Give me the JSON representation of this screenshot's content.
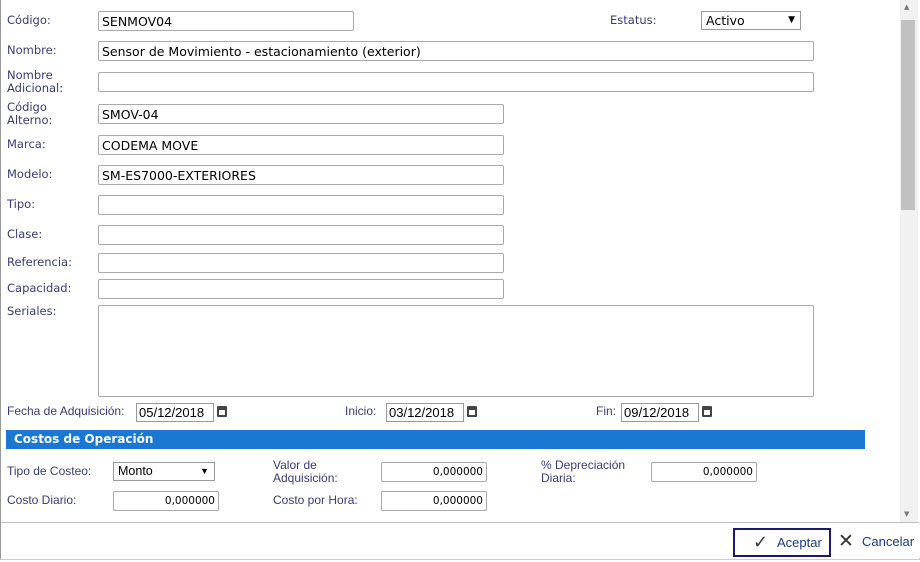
{
  "fields": {
    "codigo": {
      "label": "Código:",
      "value": "SENMOV04"
    },
    "estatus": {
      "label": "Estatus:",
      "value": "Activo"
    },
    "nombre": {
      "label": "Nombre:",
      "value": "Sensor de Movimiento - estacionamiento (exterior)"
    },
    "nombre_adicional": {
      "label": "Nombre Adicional:",
      "value": ""
    },
    "codigo_alterno": {
      "label": "Código Alterno:",
      "value": "SMOV-04"
    },
    "marca": {
      "label": "Marca:",
      "value": "CODEMA MOVE"
    },
    "modelo": {
      "label": "Modelo:",
      "value": "SM-ES7000-EXTERIORES"
    },
    "tipo": {
      "label": "Tipo:",
      "value": ""
    },
    "clase": {
      "label": "Clase:",
      "value": ""
    },
    "referencia": {
      "label": "Referencia:",
      "value": ""
    },
    "capacidad": {
      "label": "Capacidad:",
      "value": ""
    },
    "seriales": {
      "label": "Seriales:",
      "value": ""
    },
    "fecha_adquisicion": {
      "label": "Fecha de Adquisición:",
      "value": "05/12/2018"
    },
    "inicio": {
      "label": "Inicio:",
      "value": "03/12/2018"
    },
    "fin": {
      "label": "Fin:",
      "value": "09/12/2018"
    }
  },
  "costos": {
    "title": "Costos de Operación",
    "tipo_costeo": {
      "label": "Tipo de Costeo:",
      "value": "Monto"
    },
    "valor_adquisicion": {
      "label": "Valor de Adquisición:",
      "value": "0,000000"
    },
    "depreciacion": {
      "label": "% Depreciación Diaria:",
      "value": "0,000000"
    },
    "costo_diario": {
      "label": "Costo Diario:",
      "value": "0,000000"
    },
    "costo_hora": {
      "label": "Costo por Hora:",
      "value": "0,000000"
    }
  },
  "footer": {
    "accept": "Aceptar",
    "cancel": "Cancelar"
  }
}
